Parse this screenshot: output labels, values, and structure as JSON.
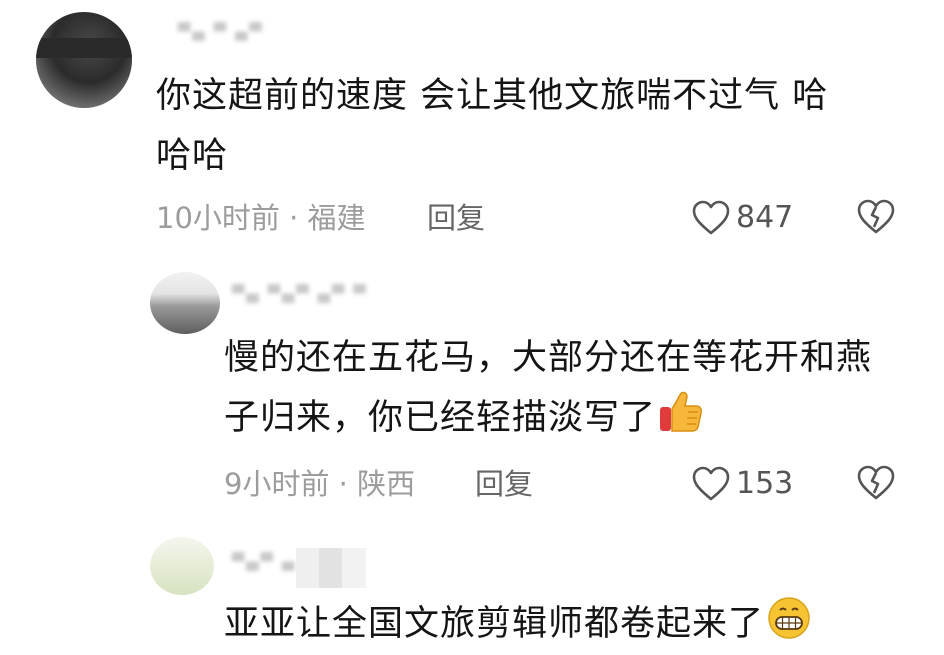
{
  "comments": [
    {
      "text_line1": "你这超前的速度   会让其他文旅喘不过气  哈",
      "text_line2": "哈哈",
      "meta": "10小时前 · 福建",
      "reply_label": "回复",
      "likes": "847"
    },
    {
      "text_line1": "慢的还在五花马，大部分还在等花开和燕",
      "text_line2": "子归来，你已经轻描淡写了",
      "emoji": "thumbs-up",
      "meta": "9小时前 · 陕西",
      "reply_label": "回复",
      "likes": "153"
    },
    {
      "text_line1": "亚亚让全国文旅剪辑师都卷起来了",
      "emoji": "grinning-face"
    }
  ],
  "colors": {
    "text": "#151515",
    "meta": "#9c9c9c",
    "icon": "#555555"
  }
}
